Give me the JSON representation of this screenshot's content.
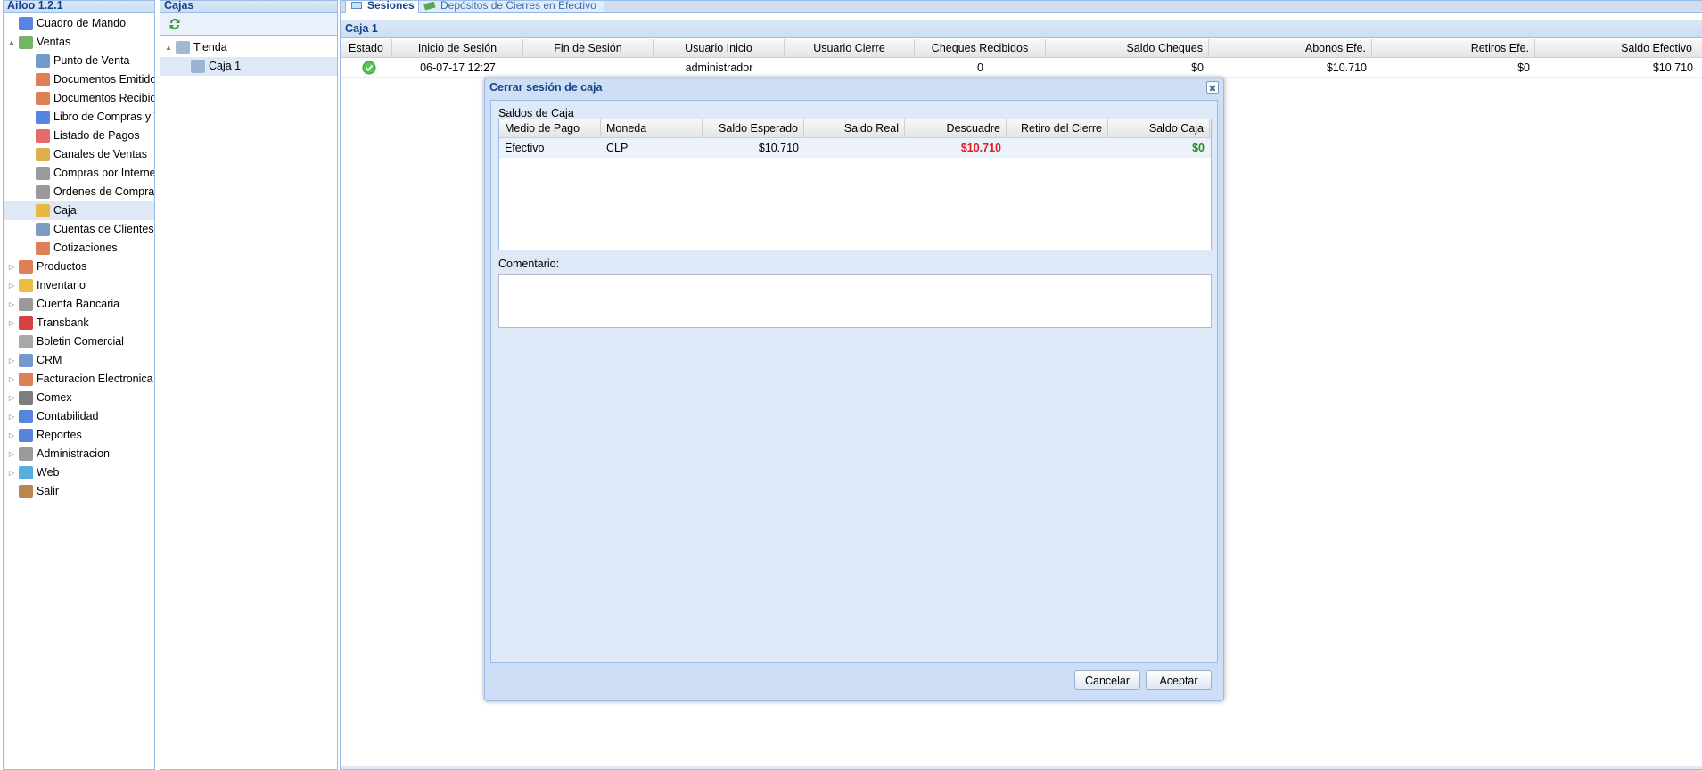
{
  "left_panel": {
    "title": "Ailoo 1.2.1",
    "items": [
      {
        "label": "Cuadro de Mando",
        "level": 0,
        "expander": "",
        "icon": "chart-icon",
        "color": "#3a6fd8"
      },
      {
        "label": "Ventas",
        "level": 0,
        "expander": "▲",
        "icon": "money-icon",
        "color": "#5aa84a"
      },
      {
        "label": "Punto de Venta",
        "level": 1,
        "expander": "",
        "icon": "monitor-icon",
        "color": "#5b87c5"
      },
      {
        "label": "Documentos Emitidos",
        "level": 1,
        "expander": "",
        "icon": "document-icon",
        "color": "#d8683a"
      },
      {
        "label": "Documentos Recibidos",
        "level": 1,
        "expander": "",
        "icon": "document-icon",
        "color": "#d8683a"
      },
      {
        "label": "Libro de Compras y Ventas",
        "level": 1,
        "expander": "",
        "icon": "book-icon",
        "color": "#3a6fd8"
      },
      {
        "label": "Listado de Pagos",
        "level": 1,
        "expander": "",
        "icon": "card-icon",
        "color": "#e05050"
      },
      {
        "label": "Canales de Ventas",
        "level": 1,
        "expander": "",
        "icon": "cart-icon",
        "color": "#d8a030"
      },
      {
        "label": "Compras por Internet",
        "level": 1,
        "expander": "",
        "icon": "cart-icon",
        "color": "#888888"
      },
      {
        "label": "Ordenes de Compras",
        "level": 1,
        "expander": "",
        "icon": "cart-icon",
        "color": "#888888"
      },
      {
        "label": "Caja",
        "level": 1,
        "expander": "",
        "icon": "coins-icon",
        "color": "#e8b020"
      },
      {
        "label": "Cuentas de Clientes",
        "level": 1,
        "expander": "",
        "icon": "id-card-icon",
        "color": "#6a8ab8"
      },
      {
        "label": "Cotizaciones",
        "level": 1,
        "expander": "",
        "icon": "document-icon",
        "color": "#d8683a"
      },
      {
        "label": "Productos",
        "level": 0,
        "expander": "▷",
        "icon": "box-icon",
        "color": "#d8683a"
      },
      {
        "label": "Inventario",
        "level": 0,
        "expander": "▷",
        "icon": "package-icon",
        "color": "#e8b020"
      },
      {
        "label": "Cuenta Bancaria",
        "level": 0,
        "expander": "▷",
        "icon": "bank-icon",
        "color": "#888888"
      },
      {
        "label": "Transbank",
        "level": 0,
        "expander": "▷",
        "icon": "transbank-icon",
        "color": "#d02020"
      },
      {
        "label": "Boletin Comercial",
        "level": 0,
        "expander": "",
        "icon": "tag-icon",
        "color": "#999999"
      },
      {
        "label": "CRM",
        "level": 0,
        "expander": "▷",
        "icon": "users-icon",
        "color": "#5b87c5"
      },
      {
        "label": "Facturacion Electronica",
        "level": 0,
        "expander": "▷",
        "icon": "document-icon",
        "color": "#d8683a"
      },
      {
        "label": "Comex",
        "level": 0,
        "expander": "▷",
        "icon": "truck-icon",
        "color": "#666666"
      },
      {
        "label": "Contabilidad",
        "level": 0,
        "expander": "▷",
        "icon": "ledger-icon",
        "color": "#3a6fd8"
      },
      {
        "label": "Reportes",
        "level": 0,
        "expander": "▷",
        "icon": "bar-chart-icon",
        "color": "#3a6fd8"
      },
      {
        "label": "Administracion",
        "level": 0,
        "expander": "▷",
        "icon": "gear-icon",
        "color": "#888888"
      },
      {
        "label": "Web",
        "level": 0,
        "expander": "▷",
        "icon": "globe-icon",
        "color": "#3aa0d8"
      },
      {
        "label": "Salir",
        "level": 0,
        "expander": "",
        "icon": "exit-icon",
        "color": "#b07030"
      }
    ],
    "selected": "Caja"
  },
  "mid_panel": {
    "title": "Cajas",
    "tree": [
      {
        "label": "Tienda",
        "level": 0,
        "expander": "▲",
        "icon": "building-icon"
      },
      {
        "label": "Caja 1",
        "level": 1,
        "expander": "",
        "icon": "monitor-icon"
      }
    ],
    "selected": "Caja 1"
  },
  "tabs": [
    {
      "label": "Sesiones",
      "active": true,
      "icon": "monitor-icon"
    },
    {
      "label": "Depósitos de Cierres en Efectivo",
      "active": false,
      "icon": "money-icon"
    }
  ],
  "sessions": {
    "title": "Caja 1",
    "columns": [
      "Estado",
      "Inicio de Sesión",
      "Fin de Sesión",
      "Usuario Inicio",
      "Usuario Cierre",
      "Cheques Recibidos",
      "Saldo Cheques",
      "Abonos Efe.",
      "Retiros Efe.",
      "Saldo Efectivo"
    ],
    "rows": [
      {
        "estado": "ok",
        "inicio": "06-07-17 12:27",
        "fin": "",
        "usuario_inicio": "administrador",
        "usuario_cierre": "",
        "cheques_recibidos": "0",
        "saldo_cheques": "$0",
        "abonos_efe": "$10.710",
        "retiros_efe": "$0",
        "saldo_efectivo": "$10.710"
      }
    ]
  },
  "modal": {
    "title": "Cerrar sesión de caja",
    "section_label": "Saldos de Caja",
    "columns": [
      "Medio de Pago",
      "Moneda",
      "Saldo Esperado",
      "Saldo Real",
      "Descuadre",
      "Retiro del Cierre",
      "Saldo Caja"
    ],
    "rows": [
      {
        "medio": "Efectivo",
        "moneda": "CLP",
        "saldo_esperado": "$10.710",
        "saldo_real": "",
        "descuadre": "$10.710",
        "retiro": "",
        "saldo_caja": "$0"
      }
    ],
    "comment_label": "Comentario:",
    "comment_value": "",
    "cancel_label": "Cancelar",
    "accept_label": "Aceptar",
    "colors": {
      "negative": "#e02020",
      "positive": "#2a8a2a"
    }
  }
}
